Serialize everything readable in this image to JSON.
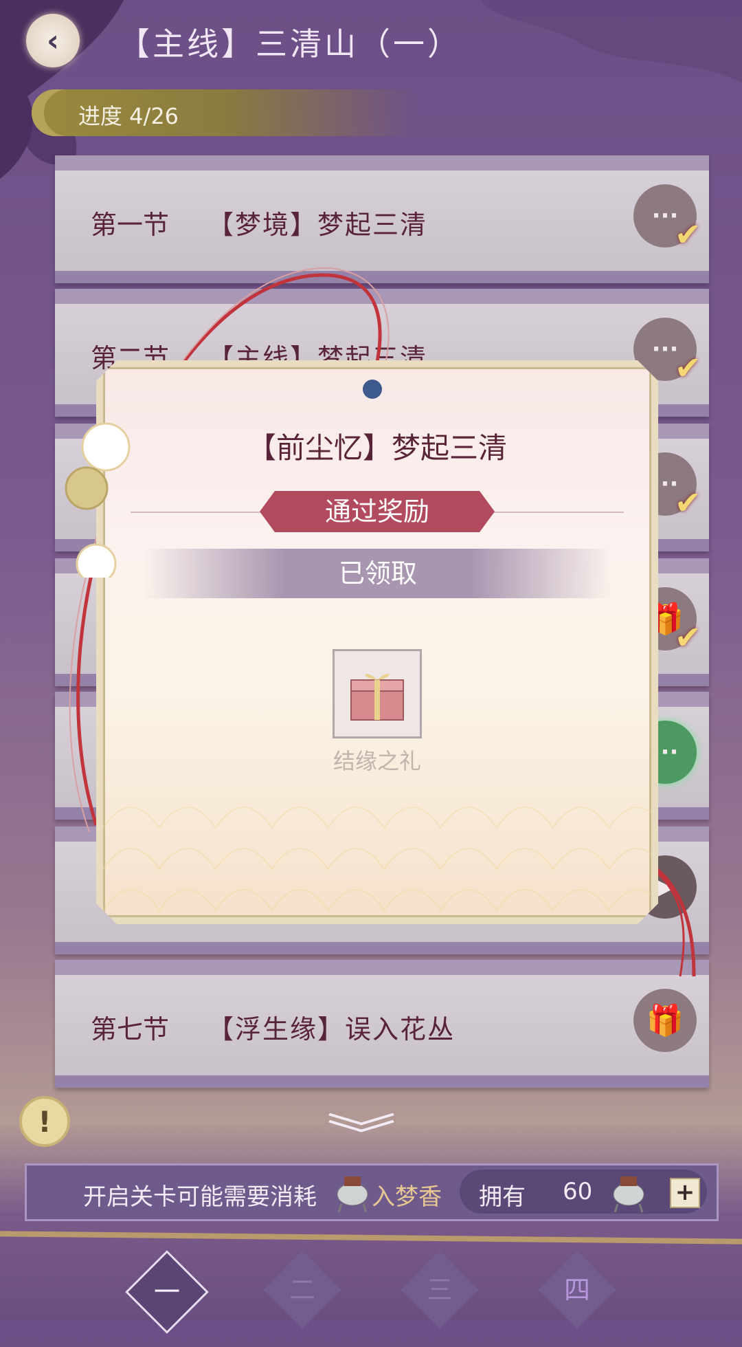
{
  "header": {
    "title": "【主线】三清山（一）",
    "progress": "进度 4/26"
  },
  "rows": [
    {
      "sec": "第一节",
      "name": "【梦境】梦起三清",
      "icon": "chat-icon",
      "claimed": true
    },
    {
      "sec": "第二节",
      "name": "【主线】梦起三清",
      "icon": "chat-icon",
      "claimed": true
    },
    {
      "sec": "",
      "name": "",
      "icon": "chat-icon",
      "claimed": true
    },
    {
      "sec": "",
      "name": "",
      "icon": "gift-icon",
      "claimed": true
    },
    {
      "sec": "",
      "name": "",
      "icon": "chat-icon-active",
      "claimed": false
    },
    {
      "sec": "",
      "name": "",
      "icon": "video-icon",
      "claimed": false
    },
    {
      "sec": "第七节",
      "name": "【浮生缘】误入花丛",
      "icon": "gift-icon",
      "claimed": false
    }
  ],
  "modal": {
    "title": "【前尘忆】梦起三清",
    "reward_banner": "通过奖励",
    "status": "已领取",
    "item_name": "结缘之礼"
  },
  "footer": {
    "info_text": "开启关卡可能需要消耗",
    "incense_name": "入梦香",
    "have_label": "拥有",
    "have_count": "60",
    "plus": "+"
  },
  "tabs": [
    "一",
    "二",
    "三",
    "四"
  ],
  "colors": {
    "accent_red": "#b14a5e",
    "text_dark": "#5a2438",
    "bg_purple": "#6b4f86"
  }
}
